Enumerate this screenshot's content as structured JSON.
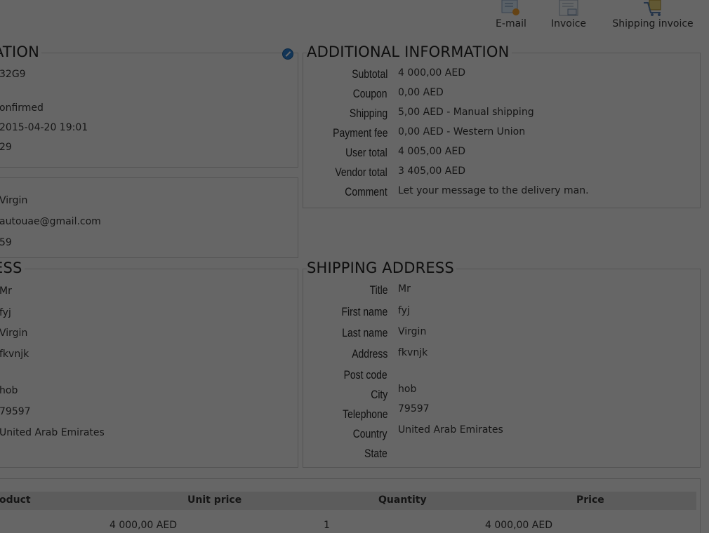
{
  "toolbar": {
    "email_label": "E-mail",
    "invoice_label": "Invoice",
    "shipping_invoice_label": "Shipping invoice"
  },
  "order_information": {
    "legend": "ATION",
    "values": [
      "32G9",
      "",
      "onfirmed",
      "2015-04-20 19:01",
      "29"
    ]
  },
  "customer": {
    "values": [
      "Virgin",
      "autouae@gmail.com",
      "59"
    ]
  },
  "billing_address": {
    "legend": "ESS",
    "values": [
      "Mr",
      "fyj",
      "Virgin",
      "fkvnjk",
      "",
      "hob",
      "79597",
      "United Arab Emirates"
    ]
  },
  "additional_information": {
    "legend": "ADDITIONAL INFORMATION",
    "rows": [
      {
        "label": "Subtotal",
        "value": "4 000,00 AED"
      },
      {
        "label": "Coupon",
        "value": "0,00 AED"
      },
      {
        "label": "Shipping",
        "value": "5,00 AED - Manual shipping"
      },
      {
        "label": "Payment fee",
        "value": "0,00 AED - Western Union"
      },
      {
        "label": "User total",
        "value": "4 005,00 AED"
      },
      {
        "label": "Vendor total",
        "value": "3 405,00 AED"
      },
      {
        "label": "Comment",
        "value": "Let your message to the delivery man."
      }
    ]
  },
  "shipping_address": {
    "legend": "SHIPPING ADDRESS",
    "rows": [
      {
        "label": "Title",
        "value": "Mr"
      },
      {
        "label": "First name",
        "value": "fyj"
      },
      {
        "label": "Last name",
        "value": "Virgin"
      },
      {
        "label": "Address",
        "value": "fkvnjk"
      },
      {
        "label": "Post code",
        "value": ""
      },
      {
        "label": "City",
        "value": "hob"
      },
      {
        "label": "Telephone",
        "value": "79597"
      },
      {
        "label": "Country",
        "value": "United Arab Emirates"
      },
      {
        "label": "State",
        "value": ""
      }
    ]
  },
  "products_table": {
    "headers": {
      "product": "oduct",
      "unit_price": "Unit price",
      "quantity": "Quantity",
      "price": "Price"
    },
    "rows": [
      {
        "unit_price": "4 000,00 AED",
        "quantity": "1",
        "price": "4 000,00 AED"
      }
    ]
  },
  "colors": {
    "overlay": "#000000",
    "edit_icon": "#2d7fd0",
    "table_header_bg": "#dcdcdc"
  },
  "icons": [
    "email-icon",
    "invoice-icon",
    "shipping-invoice-icon",
    "edit-icon"
  ]
}
